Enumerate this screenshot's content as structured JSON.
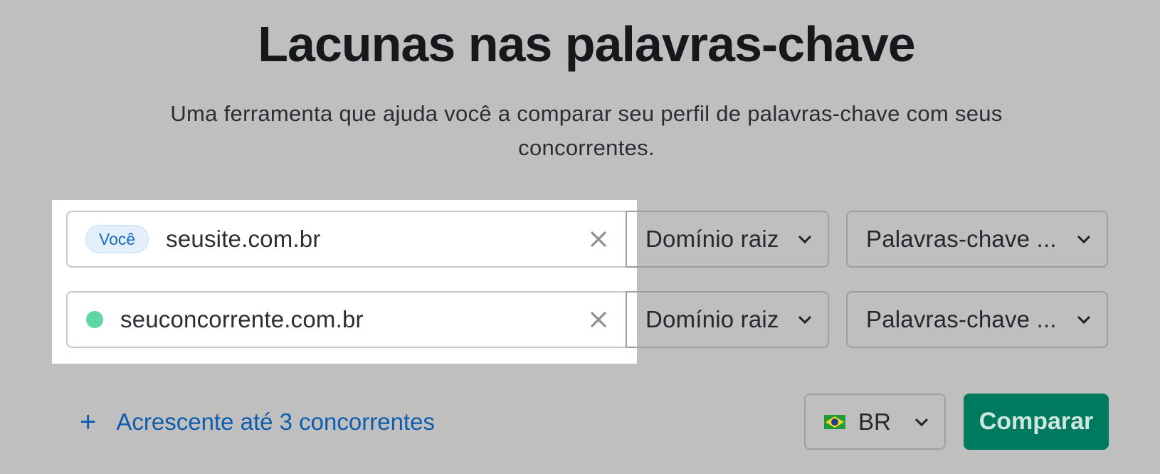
{
  "header": {
    "title": "Lacunas nas palavras-chave",
    "subtitle": "Uma ferramenta que ajuda você a comparar seu perfil de palavras-chave com seus concorrentes."
  },
  "rows": [
    {
      "badge": "Você",
      "domain": "seusite.com.br",
      "scope": "Domínio raiz",
      "keyword_type": "Palavras-chave ..."
    },
    {
      "marker_color": "#5ed6a6",
      "domain": "seuconcorrente.com.br",
      "scope": "Domínio raiz",
      "keyword_type": "Palavras-chave ..."
    }
  ],
  "footer": {
    "add_competitors_label": "Acrescente até 3 concorrentes",
    "add_icon": "plus-icon",
    "country": {
      "flag": "brazil-flag-icon",
      "code": "BR"
    },
    "compare_label": "Comparar"
  },
  "colors": {
    "background": "#bfbfbf",
    "link": "#0e5cad",
    "primary_button": "#007a5e",
    "you_badge_bg": "#e3f0fb",
    "you_badge_text": "#1a6bb8"
  }
}
